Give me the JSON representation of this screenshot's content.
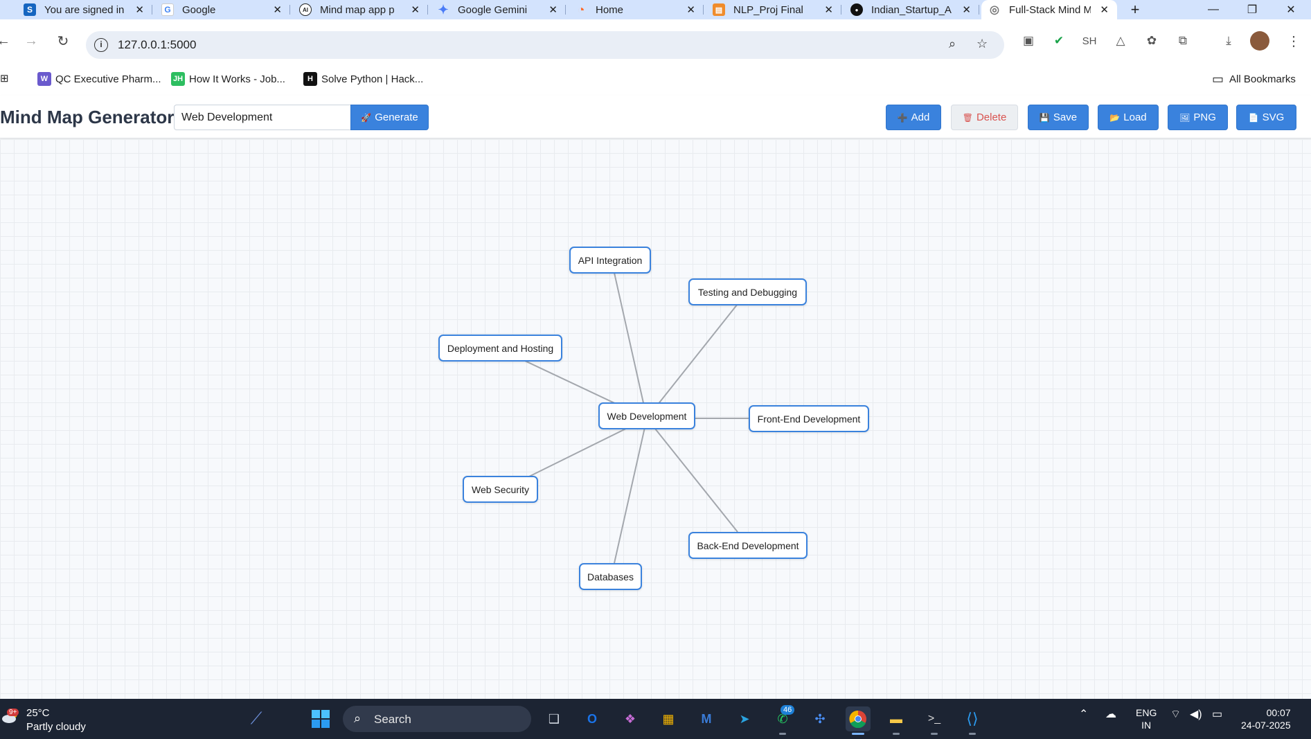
{
  "browser": {
    "tabs": [
      {
        "title": "You are signed in",
        "favicon": "S",
        "favicon_color": "#1565c0",
        "active": false
      },
      {
        "title": "Google",
        "favicon": "G",
        "favicon_color": "#4285f4",
        "active": false
      },
      {
        "title": "Mind map app p",
        "favicon": "AI",
        "favicon_color": "#222222",
        "active": false
      },
      {
        "title": "Google Gemini",
        "favicon": "✦",
        "favicon_color": "#4a7bf7",
        "active": false
      },
      {
        "title": "Home",
        "favicon": "◔",
        "favicon_color": "#ff6b2c",
        "active": false
      },
      {
        "title": "NLP_Proj Final",
        "favicon": "▤",
        "favicon_color": "#f08c2c",
        "active": false
      },
      {
        "title": "Indian_Startup_A",
        "favicon": "●",
        "favicon_color": "#111111",
        "active": false
      },
      {
        "title": "Full-Stack Mind M",
        "favicon": "◎",
        "favicon_color": "#777777",
        "active": true
      }
    ],
    "url": "127.0.0.1:5000",
    "bookmarks": [
      {
        "label": "QC Executive Pharm...",
        "favicon": "W",
        "color": "#6a5acd"
      },
      {
        "label": "How It Works - Job...",
        "favicon": "JH",
        "color": "#2dbe60"
      },
      {
        "label": "Solve Python | Hack...",
        "favicon": "H",
        "color": "#111111"
      }
    ],
    "all_bookmarks_label": "All Bookmarks",
    "profile_initials": "SH"
  },
  "app": {
    "title": "Mind Map Generator",
    "topic_value": "Web Development",
    "buttons": {
      "generate": "Generate",
      "add": "Add",
      "delete": "Delete",
      "save": "Save",
      "load": "Load",
      "png": "PNG",
      "svg": "SVG"
    }
  },
  "mindmap": {
    "center": "Web Development",
    "nodes": [
      "API Integration",
      "Testing and Debugging",
      "Deployment and Hosting",
      "Front-End Development",
      "Web Security",
      "Back-End Development",
      "Databases"
    ]
  },
  "taskbar": {
    "weather_temp": "25°C",
    "weather_desc": "Partly cloudy",
    "weather_badge": "9+",
    "search_label": "Search",
    "whatsapp_badge": "46",
    "lang_line1": "ENG",
    "lang_line2": "IN",
    "time": "00:07",
    "date": "24-07-2025"
  },
  "colors": {
    "accent": "#3a82dd",
    "delete_text": "#d9534f",
    "tabstrip": "#d3e3fd",
    "taskbar": "#1c2433"
  }
}
